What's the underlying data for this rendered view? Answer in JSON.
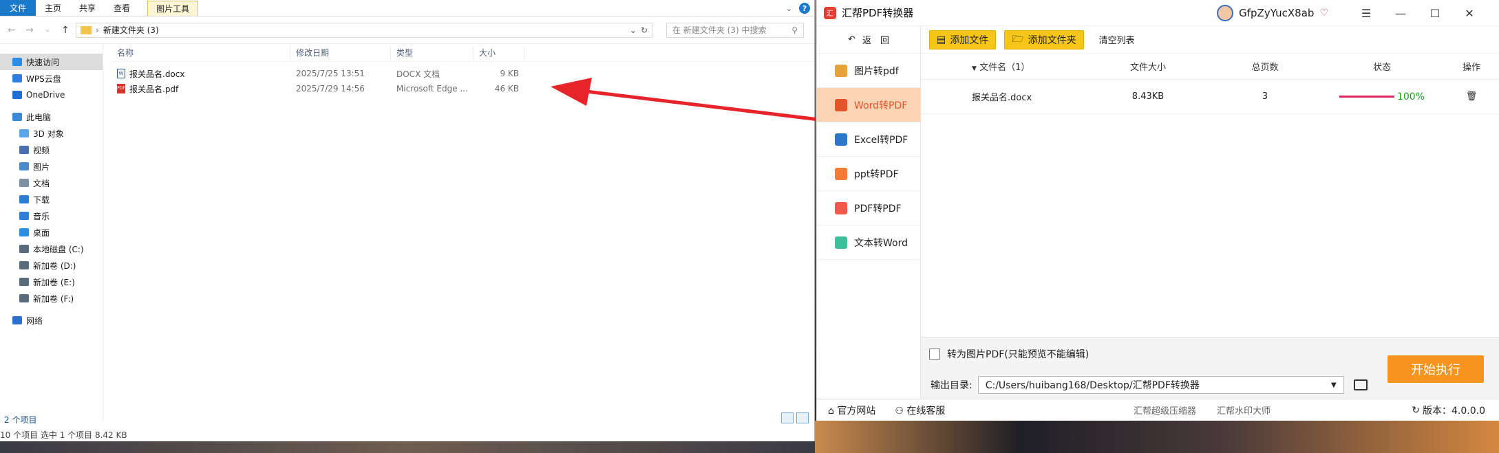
{
  "explorer": {
    "ribbon_tabs": [
      "文件",
      "主页",
      "共享",
      "查看"
    ],
    "tools_tab": "图片工具",
    "address": "新建文件夹 (3)",
    "search_placeholder": "在 新建文件夹 (3) 中搜索",
    "nav": [
      {
        "label": "快速访问",
        "icon": "star-icon",
        "color": "#2b8ee6",
        "selected": true,
        "level": "top"
      },
      {
        "label": "WPS云盘",
        "icon": "cloud-icon",
        "color": "#2f7de1",
        "level": "top"
      },
      {
        "label": "OneDrive",
        "icon": "onedrive-icon",
        "color": "#1f6fd6",
        "level": "top"
      },
      {
        "label": "此电脑",
        "icon": "computer-icon",
        "color": "#3a8ad8",
        "level": "top"
      },
      {
        "label": "3D 对象",
        "icon": "cube-icon",
        "color": "#5aa4e8",
        "level": "sub"
      },
      {
        "label": "视频",
        "icon": "video-icon",
        "color": "#4b6fae",
        "level": "sub"
      },
      {
        "label": "图片",
        "icon": "picture-icon",
        "color": "#4a8acb",
        "level": "sub"
      },
      {
        "label": "文档",
        "icon": "document-icon",
        "color": "#7f8fa6",
        "level": "sub"
      },
      {
        "label": "下载",
        "icon": "download-icon",
        "color": "#2b7cd3",
        "level": "sub"
      },
      {
        "label": "音乐",
        "icon": "music-icon",
        "color": "#2f7ed8",
        "level": "sub"
      },
      {
        "label": "桌面",
        "icon": "desktop-icon",
        "color": "#2b8ee6",
        "level": "sub"
      },
      {
        "label": "本地磁盘 (C:)",
        "icon": "drive-icon",
        "color": "#5a6b7c",
        "level": "sub"
      },
      {
        "label": "新加卷 (D:)",
        "icon": "drive-icon",
        "color": "#5a6b7c",
        "level": "sub"
      },
      {
        "label": "新加卷 (E:)",
        "icon": "drive-icon",
        "color": "#5a6b7c",
        "level": "sub"
      },
      {
        "label": "新加卷 (F:)",
        "icon": "drive-icon",
        "color": "#5a6b7c",
        "level": "sub"
      },
      {
        "label": "网络",
        "icon": "network-icon",
        "color": "#2b6fd0",
        "level": "top"
      }
    ],
    "columns": [
      "名称",
      "修改日期",
      "类型",
      "大小"
    ],
    "files": [
      {
        "name": "报关品名.docx",
        "date": "2025/7/25 13:51",
        "type": "DOCX 文档",
        "size": "9 KB",
        "icon": "word-file-icon"
      },
      {
        "name": "报关品名.pdf",
        "date": "2025/7/29 14:56",
        "type": "Microsoft Edge ...",
        "size": "46 KB",
        "icon": "pdf-file-icon"
      }
    ],
    "status_count": "2 个项目",
    "status_selected": "10 个项目    选中 1 个项目  8.42 KB"
  },
  "app": {
    "title": "汇帮PDF转换器",
    "username": "GfpZyYucX8ab",
    "back_label": "返　回",
    "menu": [
      {
        "label": "图片转pdf",
        "icon": "image-icon",
        "color": "#e8a23a"
      },
      {
        "label": "Word转PDF",
        "icon": "word-icon",
        "color": "#e4542a",
        "active": true
      },
      {
        "label": "Excel转PDF",
        "icon": "excel-icon",
        "color": "#2a78c7"
      },
      {
        "label": "ppt转PDF",
        "icon": "ppt-icon",
        "color": "#f27c36"
      },
      {
        "label": "PDF转PDF",
        "icon": "pdf-icon",
        "color": "#ef5a4b"
      },
      {
        "label": "文本转Word",
        "icon": "text-icon",
        "color": "#3cbf9a"
      }
    ],
    "add_file": "添加文件",
    "add_folder": "添加文件夹",
    "clear_list": "清空列表",
    "table_headers": [
      "文件名（1）",
      "文件大小",
      "总页数",
      "状态",
      "操作"
    ],
    "rows": [
      {
        "name": "报关品名.docx",
        "size": "8.43KB",
        "pages": "3",
        "status": "100%"
      }
    ],
    "to_image_pdf": "转为图片PDF(只能预览不能编辑)",
    "output_label": "输出目录:",
    "output_path": "C:/Users/huibang168/Desktop/汇帮PDF转换器",
    "start": "开始执行",
    "footer_site": "官方网站",
    "footer_service": "在线客服",
    "footer_links": [
      "汇帮超级压缩器",
      "汇帮水印大师"
    ],
    "version": "版本：4.0.0.0"
  }
}
